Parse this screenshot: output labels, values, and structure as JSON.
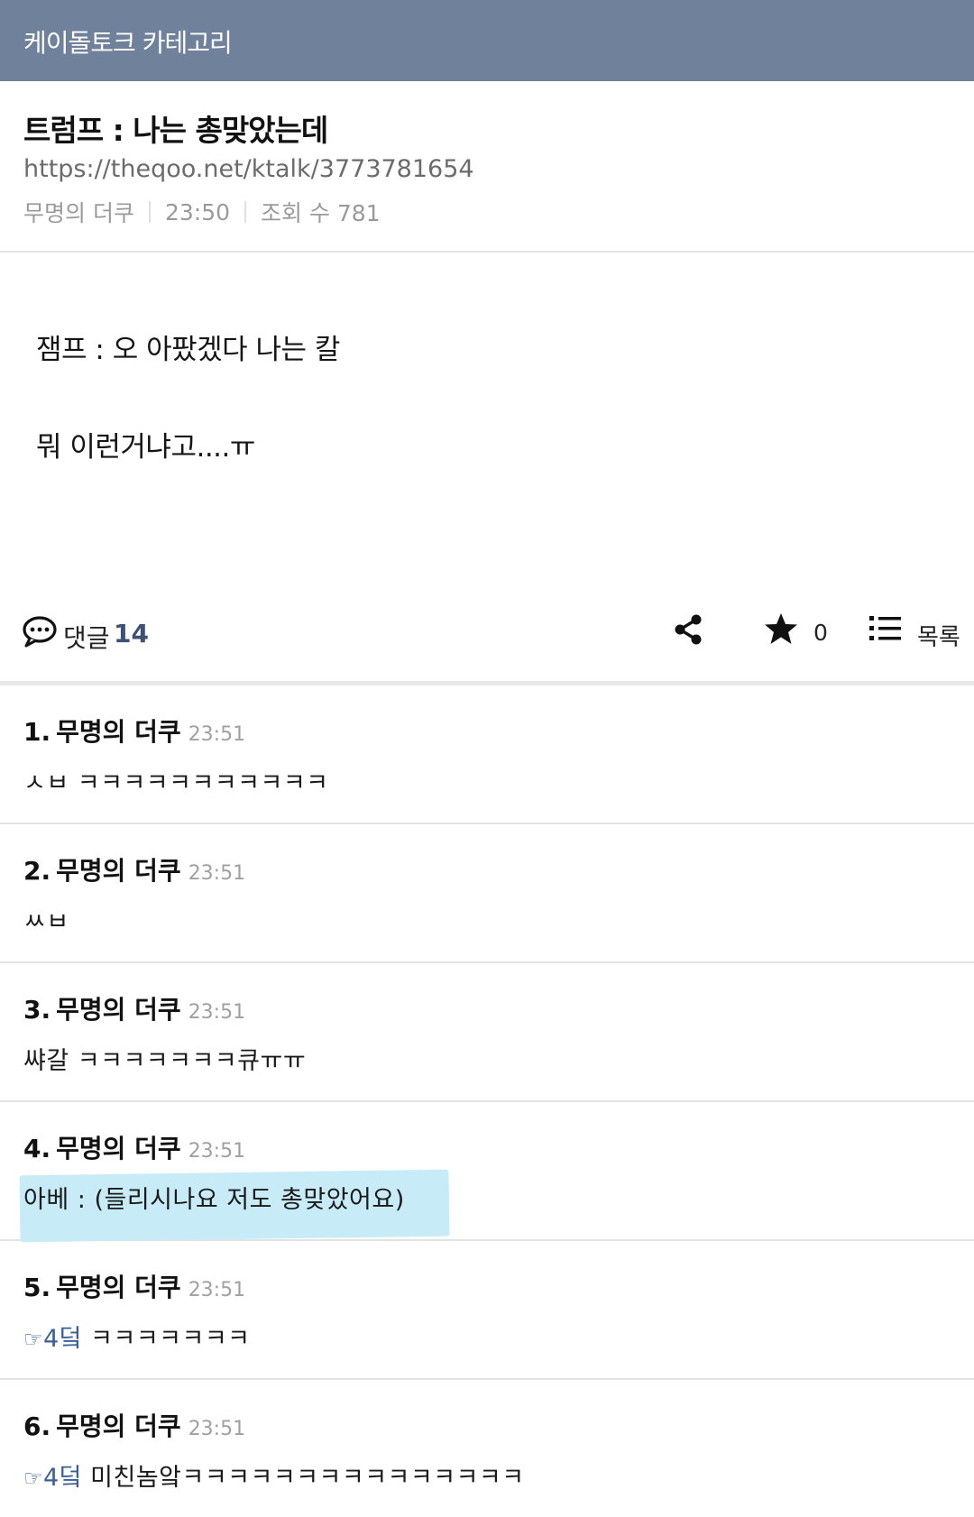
{
  "topbar": {
    "category": "케이돌토크 카테고리"
  },
  "post": {
    "title": "트럼프 : 나는 총맞았는데",
    "url": "https://theqoo.net/ktalk/3773781654",
    "author": "무명의 더쿠",
    "time": "23:50",
    "views": "조회 수 781",
    "body": [
      "잼프 : 오 아팠겠다 나는 칼",
      "뭐 이런거냐고....ㅠ"
    ]
  },
  "actions": {
    "comment_label": "댓글",
    "comment_count": "14",
    "star_count": "0",
    "list_label": "목록"
  },
  "comments": [
    {
      "num": "1.",
      "author": "무명의 더쿠",
      "time": "23:51",
      "text": "ㅅㅂ ㅋㅋㅋㅋㅋㅋㅋㅋㅋㅋㅋ"
    },
    {
      "num": "2.",
      "author": "무명의 더쿠",
      "time": "23:51",
      "text": "ㅆㅂ"
    },
    {
      "num": "3.",
      "author": "무명의 더쿠",
      "time": "23:51",
      "text": "쌰갈 ㅋㅋㅋㅋㅋㅋㅋ큐ㅠㅠ"
    },
    {
      "num": "4.",
      "author": "무명의 더쿠",
      "time": "23:51",
      "text": "아베 : (들리시나요 저도 총맞았어요)"
    },
    {
      "num": "5.",
      "author": "무명의 더쿠",
      "time": "23:51",
      "ref_hand": "☞",
      "ref": "4덬",
      "text": "ㅋㅋㅋㅋㅋㅋㅋ"
    },
    {
      "num": "6.",
      "author": "무명의 더쿠",
      "time": "23:51",
      "ref_hand": "☞",
      "ref": "4덬",
      "text": "미친놈앜ㅋㅋㅋㅋㅋㅋㅋㅋㅋㅋㅋㅋㅋㅋㅋ"
    }
  ],
  "icons": {
    "comment": "speech-bubble-icon",
    "share": "share-icon",
    "star": "star-icon",
    "list": "list-icon"
  },
  "colors": {
    "topbar": "#6f819b",
    "accent": "#3c5173",
    "highlight": "#c7ecf8"
  }
}
